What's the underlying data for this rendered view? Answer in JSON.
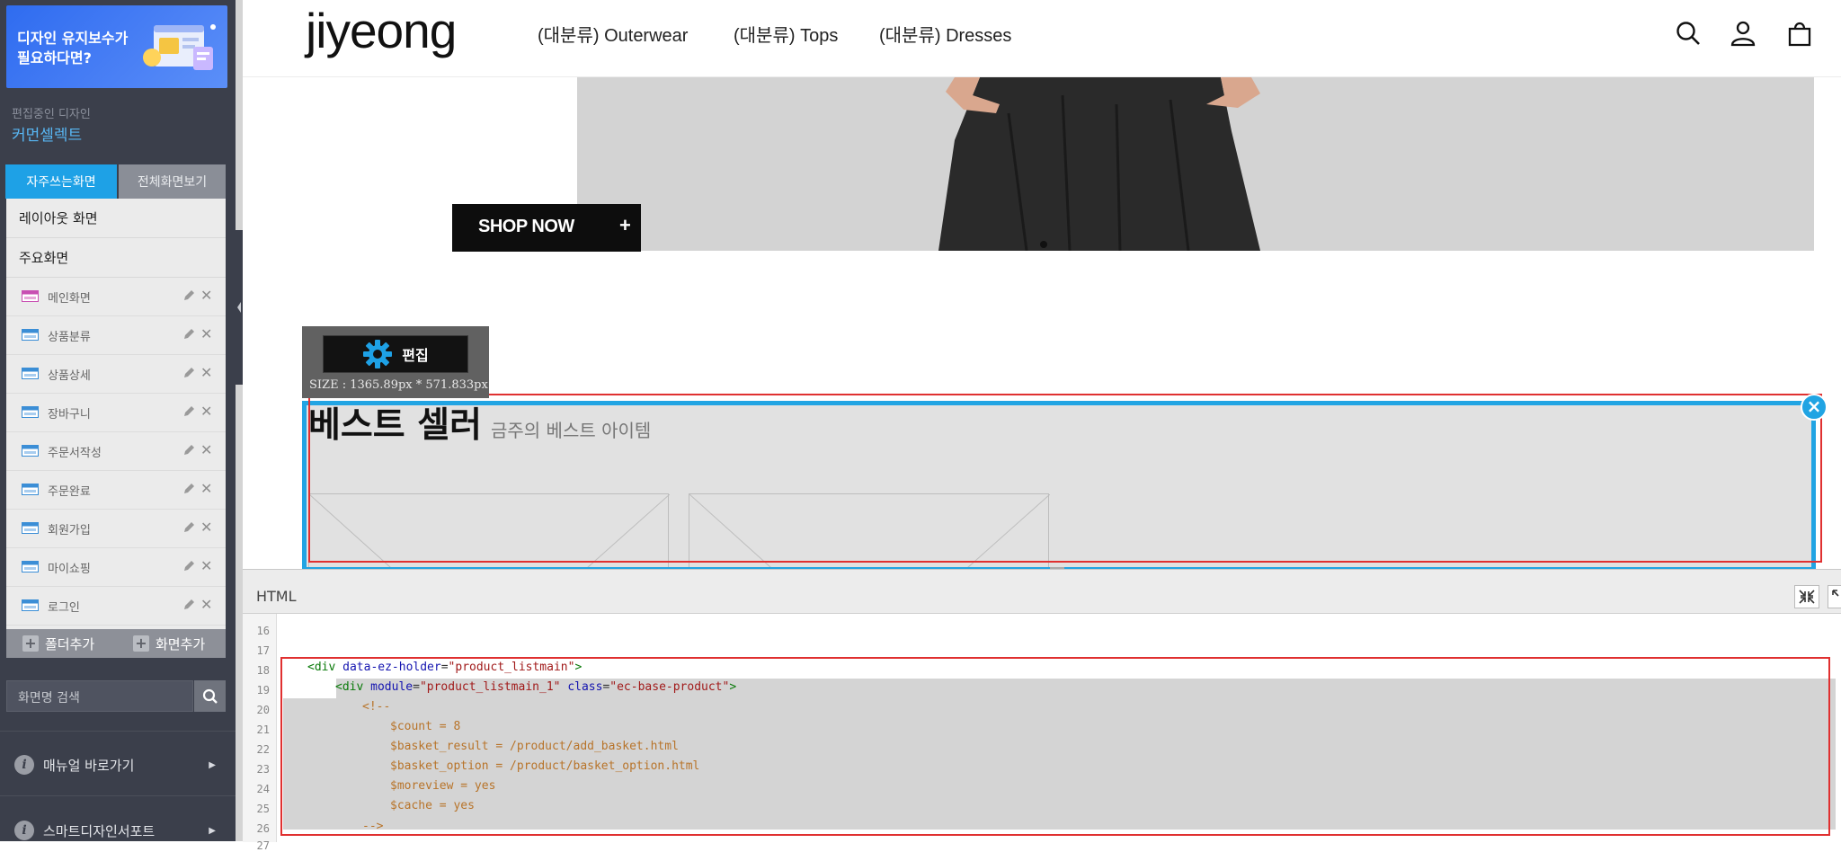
{
  "sidebar": {
    "banner": {
      "line1": "디자인 유지보수가",
      "line2": "필요하다면?"
    },
    "design_label": "편집중인 디자인",
    "design_name": "커먼셀렉트",
    "tabs": [
      "자주쓰는화면",
      "전체화면보기"
    ],
    "sections": [
      "레이아웃 화면",
      "주요화면"
    ],
    "pages": [
      "메인화면",
      "상품분류",
      "상품상세",
      "장바구니",
      "주문서작성",
      "주문완료",
      "회원가입",
      "마이쇼핑",
      "로그인"
    ],
    "add_folder": "폴더추가",
    "add_page": "화면추가",
    "search_placeholder": "화면명 검색",
    "links": [
      "매뉴얼 바로가기",
      "스마트디자인서포트"
    ]
  },
  "preview": {
    "logo": "jiyeong",
    "nav": [
      "(대분류) Outerwear",
      "(대분류) Tops",
      "(대분류) Dresses"
    ],
    "hero_button": "SHOP NOW",
    "hero_button_icon": "+",
    "edit_button": "편집",
    "size_label": "SIZE : 1365.89px * 571.833px",
    "section_title": "베스트 셀러",
    "section_subtitle": "금주의 베스트 아이템"
  },
  "editor": {
    "title": "HTML",
    "line_numbers": [
      "16",
      "17",
      "18",
      "19",
      "20",
      "21",
      "22",
      "23",
      "24",
      "25",
      "26",
      "27"
    ],
    "code": {
      "l18_open": "<div ",
      "l18_attr": "data-ez-holder",
      "l18_val": "\"product_listmain\"",
      "l18_close": ">",
      "l19_open": "<div ",
      "l19_attr1": "module",
      "l19_val1": "\"product_listmain_1\"",
      "l19_attr2": "class",
      "l19_val2": "\"ec-base-product\"",
      "l19_close": ">",
      "l20": "<!--",
      "l21": "$count = 8",
      "l22": "$basket_result = /product/add_basket.html",
      "l23": "$basket_option = /product/basket_option.html",
      "l24": "$moreview = yes",
      "l25": "$cache = yes",
      "l26": "-->"
    }
  },
  "colors": {
    "sidebar_bg": "#3b3f4b",
    "accent_blue": "#21a4e3",
    "highlight_red": "#e03030",
    "tab_active": "#1ea1e6"
  }
}
